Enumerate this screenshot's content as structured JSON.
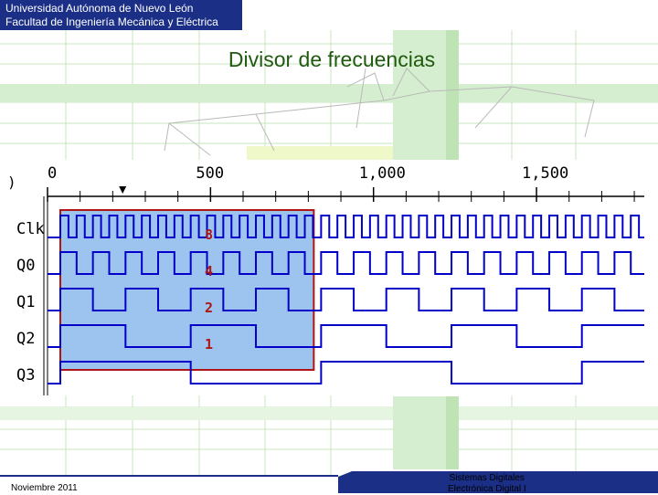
{
  "header": {
    "line1": "Universidad Autónoma de Nuevo León",
    "line2": "Facultad de Ingeniería Mecánica y Eléctrica"
  },
  "title": "Divisor de frecuencias",
  "timeline": {
    "ticks": [
      {
        "value": 0,
        "label": "0"
      },
      {
        "value": 500,
        "label": "500"
      },
      {
        "value": 1000,
        "label": "1,000"
      },
      {
        "value": 1500,
        "label": "1,500"
      }
    ],
    "marker_value": 250
  },
  "signals": [
    {
      "name": "Clk",
      "period": 50
    },
    {
      "name": "Q0",
      "period": 100
    },
    {
      "name": "Q1",
      "period": 200
    },
    {
      "name": "Q2",
      "period": 400
    },
    {
      "name": "Q3",
      "period": 800
    }
  ],
  "divisor_labels": [
    "8",
    "4",
    "2",
    "1"
  ],
  "highlight": {
    "from": 0,
    "to": 800
  },
  "colors": {
    "header_bg": "#1b2f86",
    "title": "#1f5a0e",
    "waveform": "#0000c8",
    "highlight_fill": "#9cc4ee",
    "highlight_border": "#b01515",
    "divisor_label": "#b01515"
  },
  "footer": {
    "date": "Noviembre 2011",
    "course_line1": "Sistemas Digitales",
    "course_line2": "Electrónica Digital I"
  }
}
